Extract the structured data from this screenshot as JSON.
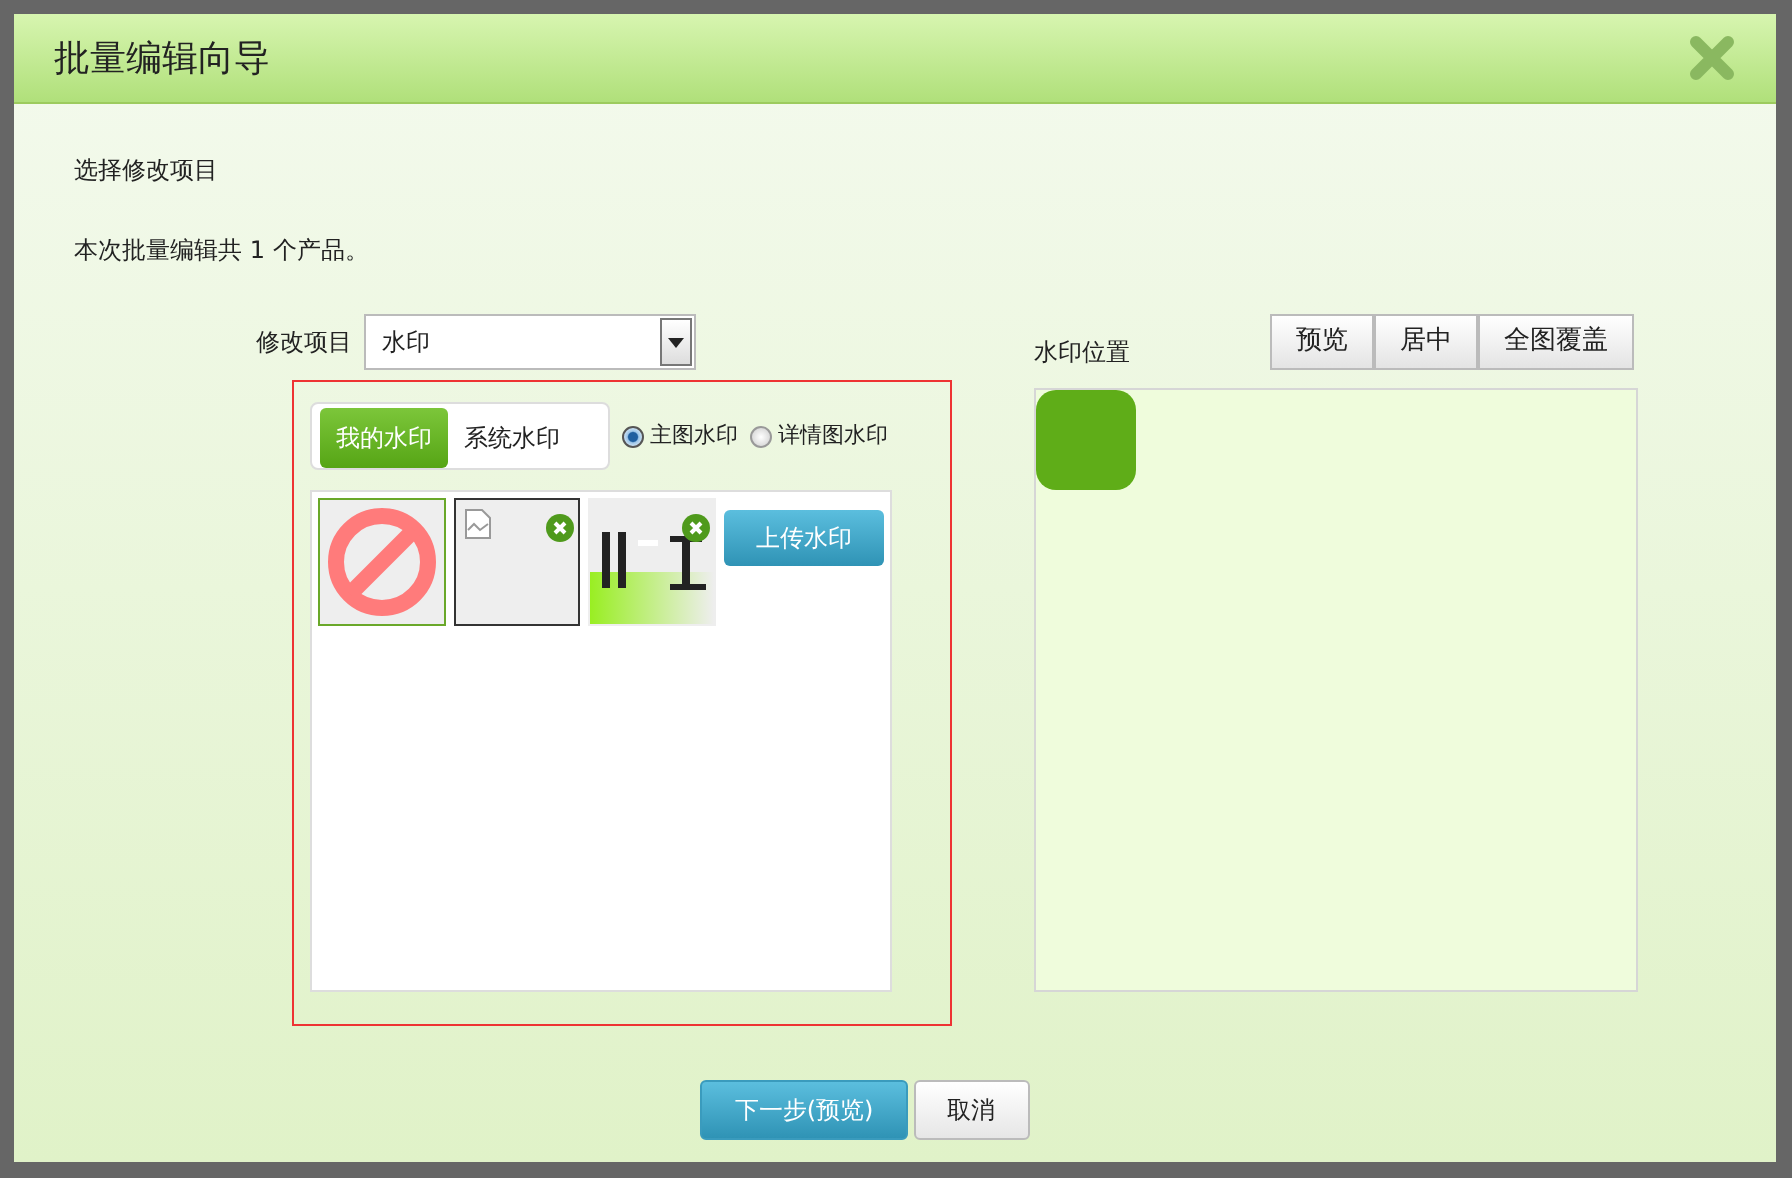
{
  "dialog": {
    "title": "批量编辑向导",
    "heading": "选择修改项目",
    "summary": "本次批量编辑共 1 个产品。",
    "field": {
      "label": "修改项目",
      "value": "水印"
    },
    "tabs": [
      {
        "label": "我的水印",
        "selected": true
      },
      {
        "label": "系统水印",
        "selected": false
      }
    ],
    "radios": [
      {
        "label": "主图水印",
        "selected": true
      },
      {
        "label": "详情图水印",
        "selected": false
      }
    ],
    "thumbnails": [
      {
        "kind": "none",
        "selected": true,
        "removable": false
      },
      {
        "kind": "broken",
        "selected": false,
        "removable": true
      },
      {
        "kind": "picture",
        "selected": false,
        "removable": true
      }
    ],
    "upload_button": "上传水印",
    "position": {
      "label": "水印位置",
      "buttons": [
        "预览",
        "居中",
        "全图覆盖"
      ]
    },
    "buttons": [
      {
        "label": "下一步(预览)",
        "kind": "primary"
      },
      {
        "label": "取消",
        "kind": "secondary"
      }
    ]
  }
}
